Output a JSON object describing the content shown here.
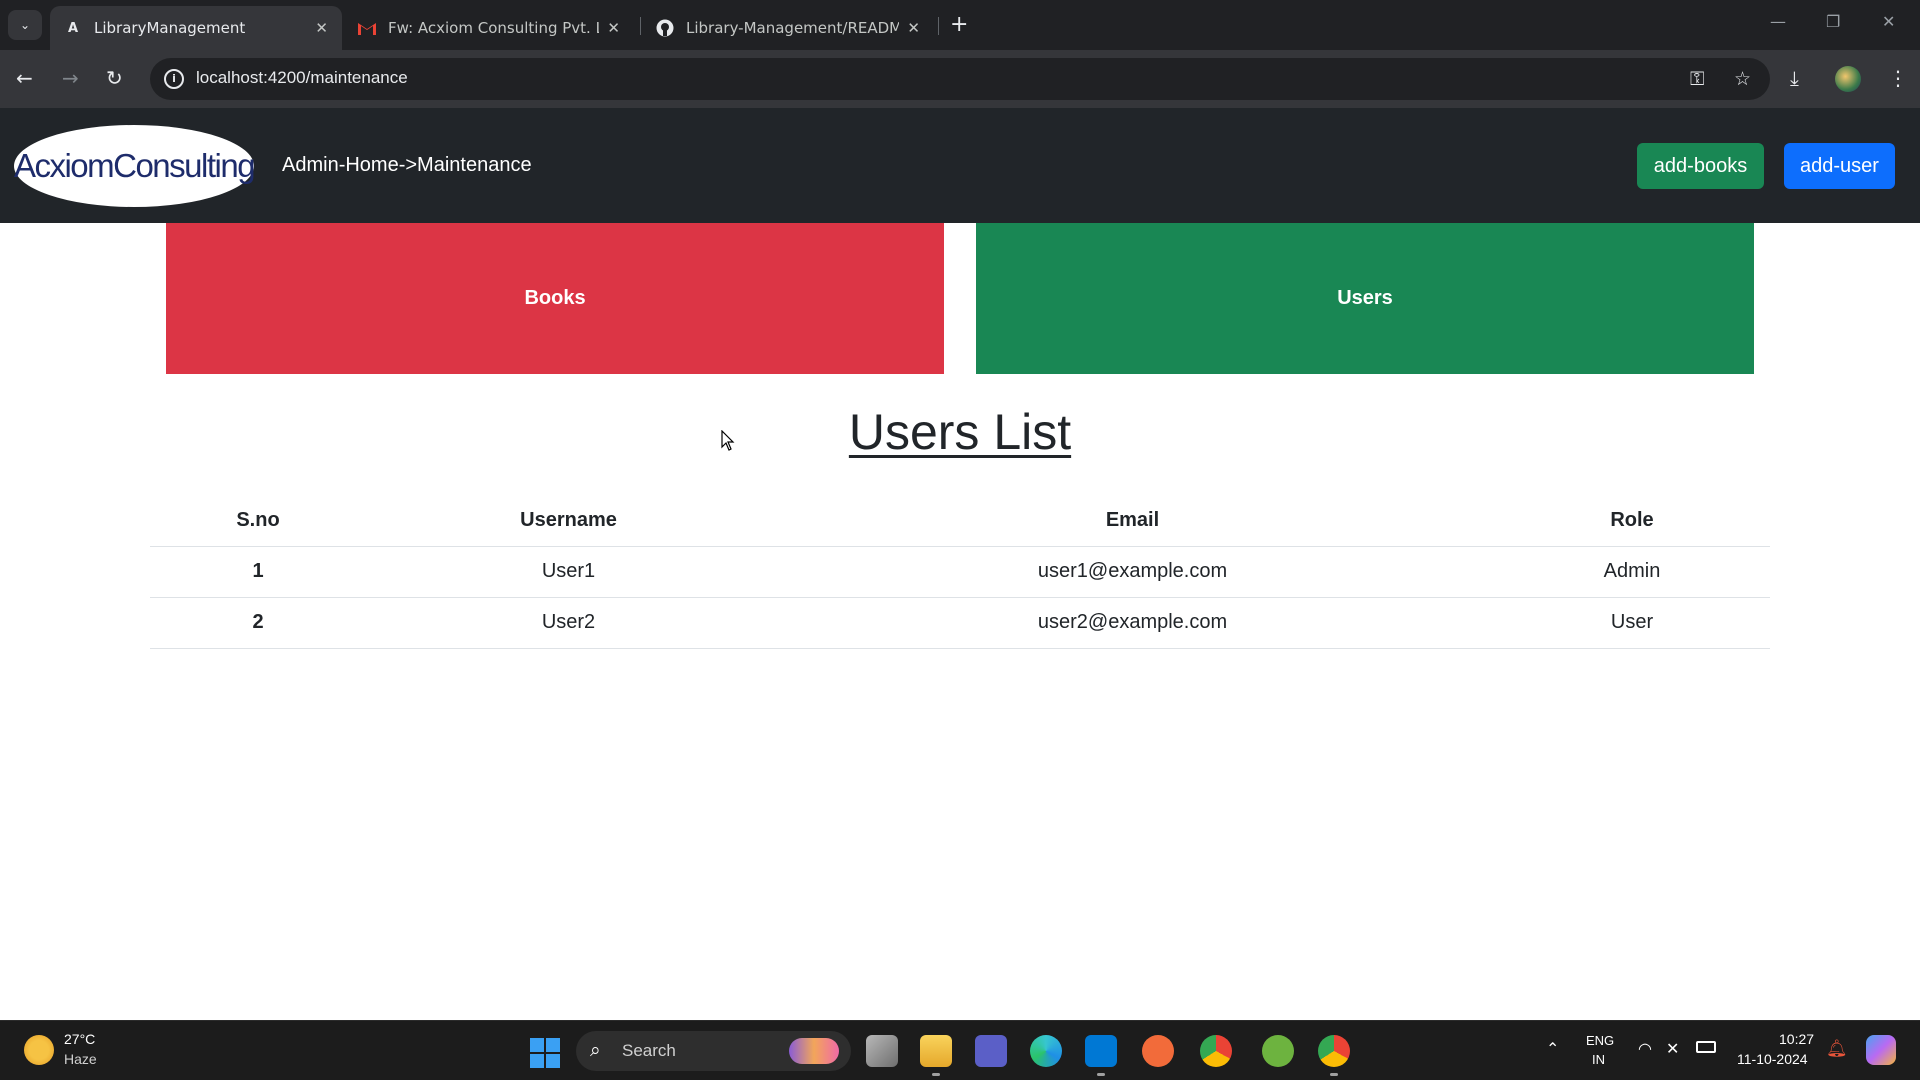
{
  "browser": {
    "tabs": [
      {
        "title": "LibraryManagement",
        "icon": "angular-icon",
        "active": true
      },
      {
        "title": "Fw: Acxiom Consulting Pvt. Ltd.",
        "icon": "gmail-icon",
        "active": false
      },
      {
        "title": "Library-Management/README.",
        "icon": "github-icon",
        "active": false
      }
    ],
    "url": "localhost:4200/maintenance"
  },
  "app": {
    "logo_text": "AcxiomConsulting",
    "breadcrumb": "Admin-Home->Maintenance",
    "buttons": {
      "add_books": "add-books",
      "add_user": "add-user"
    },
    "cards": {
      "books": "Books",
      "users": "Users"
    },
    "heading": "Users List",
    "table": {
      "headers": [
        "S.no",
        "Username",
        "Email",
        "Role"
      ],
      "rows": [
        [
          "1",
          "User1",
          "user1@example.com",
          "Admin"
        ],
        [
          "2",
          "User2",
          "user2@example.com",
          "User"
        ]
      ]
    },
    "colors": {
      "header_bg": "#212529",
      "books_card": "#dc3545",
      "users_card": "#198754",
      "add_books_btn": "#198754",
      "add_user_btn": "#0d6efd"
    }
  },
  "taskbar": {
    "weather": {
      "temp": "27°C",
      "desc": "Haze"
    },
    "search_label": "Search",
    "language": {
      "line1": "ENG",
      "line2": "IN"
    },
    "clock": {
      "time": "10:27",
      "date": "11-10-2024"
    }
  }
}
